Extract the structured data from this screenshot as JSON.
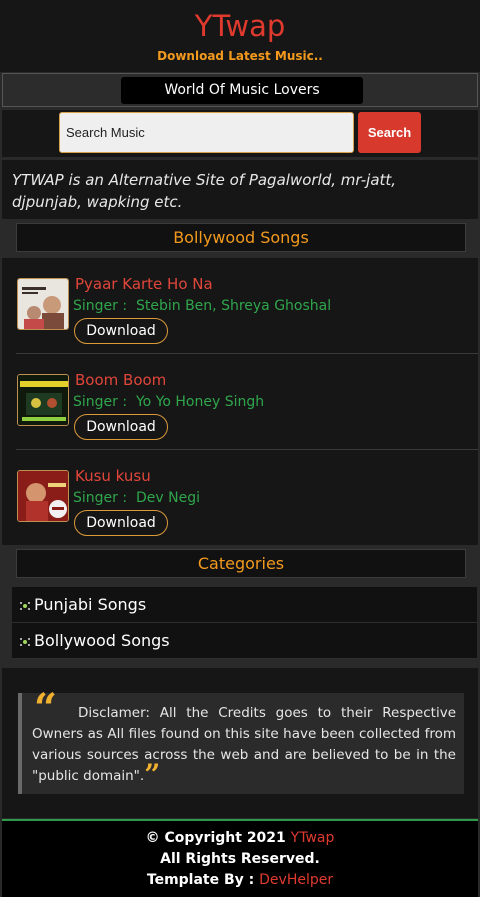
{
  "header": {
    "logo": "YTwap",
    "tagline": "Download Latest Music.."
  },
  "motto": "World Of Music Lovers",
  "search": {
    "placeholder": "Search Music",
    "button_label": "Search"
  },
  "about": "YTWAP is an Alternative Site of Pagalworld, mr-jatt, djpunjab, wapking etc.",
  "sections": {
    "songs_title": "Bollywood Songs",
    "categories_title": "Categories"
  },
  "songs": [
    {
      "title": "Pyaar Karte Ho Na",
      "singer_prefix": "Singer :",
      "singer": "Stebin Ben, Shreya Ghoshal",
      "download_label": "Download"
    },
    {
      "title": "Boom Boom",
      "singer_prefix": "Singer :",
      "singer": "Yo Yo Honey Singh",
      "download_label": "Download"
    },
    {
      "title": "Kusu kusu",
      "singer_prefix": "Singer :",
      "singer": "Dev Negi",
      "download_label": "Download"
    }
  ],
  "categories": [
    {
      "label": "Punjabi Songs"
    },
    {
      "label": "Bollywood Songs"
    }
  ],
  "disclaimer": "Disclamer: All the Credits goes to their Respective Owners as All files found on this site have been collected from various sources across the web and are believed to be in the \"public domain\".",
  "footer": {
    "copyright": "© Copyright 2021",
    "brand": "YTwap",
    "rights": "All Rights Reserved.",
    "template_by": "Template By :",
    "author": "DevHelper"
  },
  "colors": {
    "accent_red": "#e03a2f",
    "accent_orange": "#f39a1e",
    "singer_green": "#2fa64c"
  }
}
